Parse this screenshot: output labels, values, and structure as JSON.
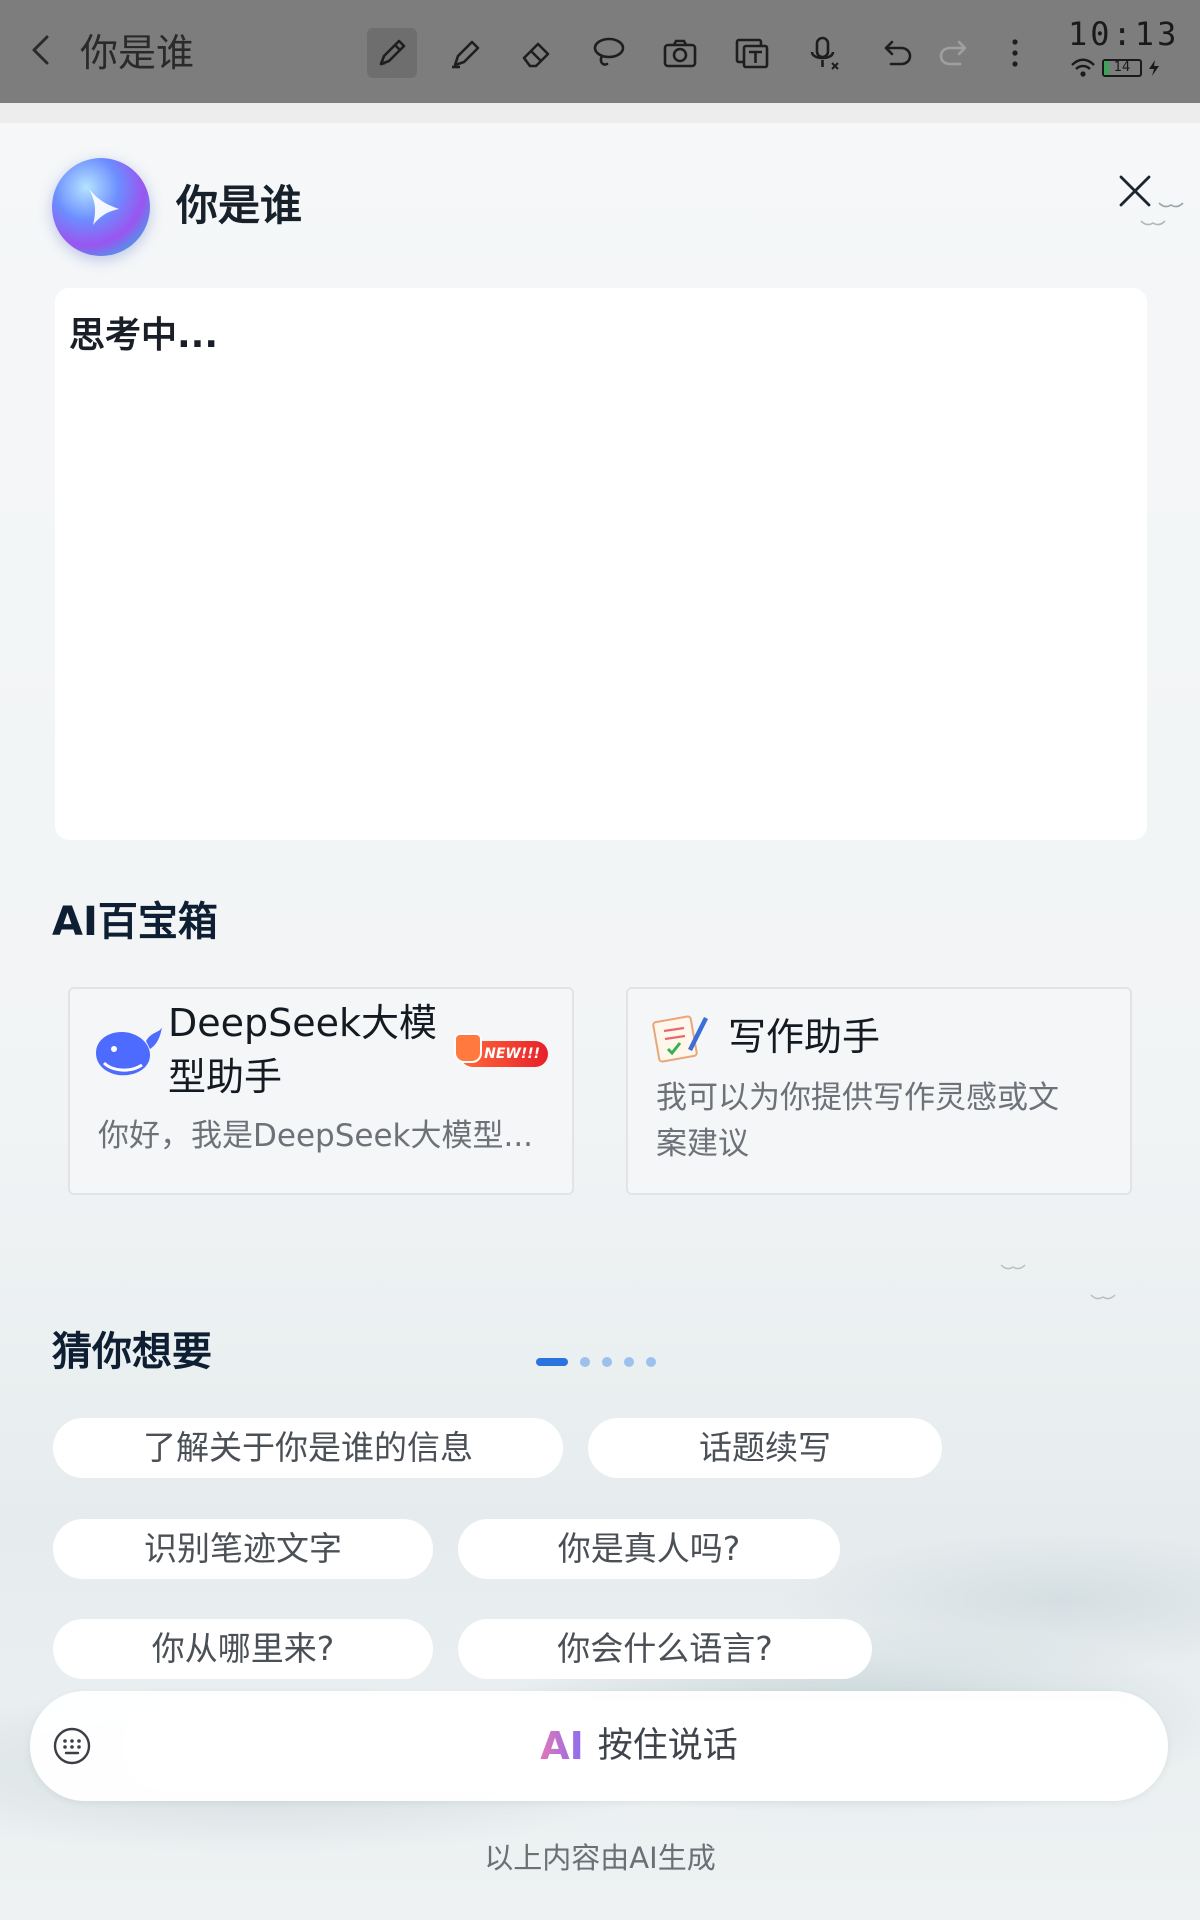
{
  "toolbar": {
    "back_icon": "chevron-left-icon",
    "doc_title": "你是谁",
    "tools": [
      "pen-icon",
      "highlighter-icon",
      "eraser-icon",
      "lasso-icon",
      "camera-icon",
      "text-recognize-icon",
      "mic-icon",
      "undo-icon",
      "redo-icon",
      "more-icon"
    ],
    "active_tool": "pen-icon"
  },
  "status": {
    "time": "10:13",
    "battery_text": "14",
    "battery_level": 0.14,
    "wifi_icon": "wifi-icon",
    "charging_icon": "bolt-icon"
  },
  "assistant": {
    "query": "你是谁",
    "answer": "思考中...",
    "close_icon": "close-icon"
  },
  "toolbox": {
    "title": "AI百宝箱",
    "cards": [
      {
        "icon": "whale-icon",
        "title_line1": "DeepSeek大模",
        "title_line2": "型助手",
        "badge": "NEW!!!",
        "desc": "你好，我是DeepSeek大模型..."
      },
      {
        "icon": "writing-notepad-icon",
        "title_line1": "写作助手",
        "desc_line1": "我可以为你提供写作灵感或文",
        "desc_line2": "案建议"
      }
    ],
    "pagination": {
      "total": 5,
      "current": 1
    }
  },
  "suggestions": {
    "title": "猜你想要",
    "chips": [
      "了解关于你是谁的信息",
      "话题续写",
      "识别笔迹文字",
      "你是真人吗?",
      "你从哪里来?",
      "你会什么语言?"
    ]
  },
  "input": {
    "keyboard_icon": "keyboard-icon",
    "ai_mark": "AI",
    "voice_label": "按住说话"
  },
  "footer": {
    "note": "以上内容由AI生成"
  },
  "colors": {
    "toolbar_bg": "#7d7d7d",
    "accent_blue": "#2a74e0",
    "new_badge": "#e8202a",
    "title_dark": "#0f1f33"
  }
}
